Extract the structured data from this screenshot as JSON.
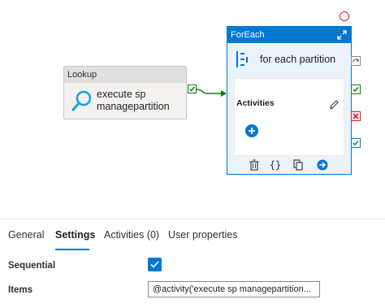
{
  "canvas": {
    "lookup": {
      "type_label": "Lookup",
      "name": "execute sp managepartition"
    },
    "foreach": {
      "type_label": "ForEach",
      "name": "for each partition",
      "activities_label": "Activities"
    }
  },
  "tabs": [
    {
      "label": "General",
      "active": false
    },
    {
      "label": "Settings",
      "active": true
    },
    {
      "label": "Activities (0)",
      "active": false
    },
    {
      "label": "User properties",
      "active": false
    }
  ],
  "settings": {
    "sequential_label": "Sequential",
    "sequential_checked": true,
    "items_label": "Items",
    "items_value": "@activity('execute sp managepartition..."
  },
  "colors": {
    "accent": "#0078d4",
    "success": "#107c10",
    "error": "#e81123"
  }
}
